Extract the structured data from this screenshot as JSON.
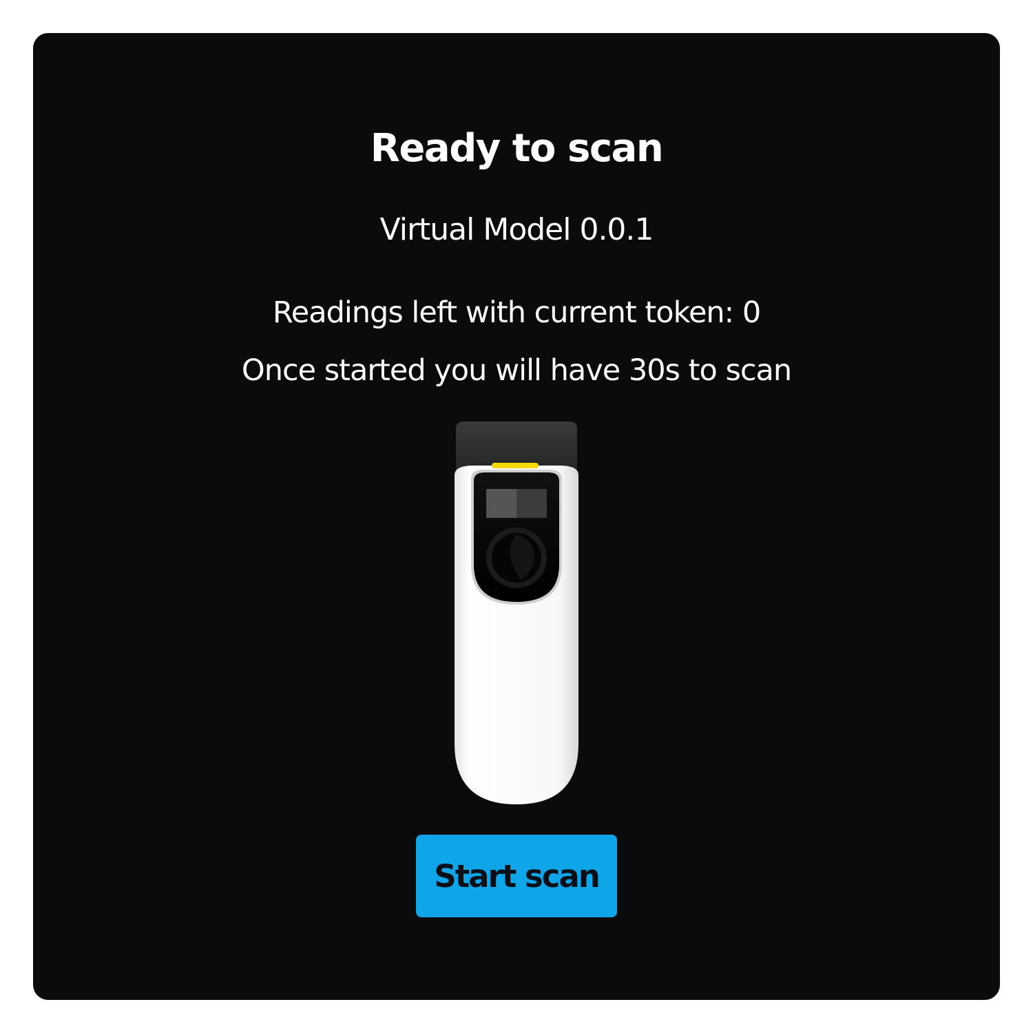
{
  "scan": {
    "title": "Ready to scan",
    "model": "Virtual Model 0.0.1",
    "readings": "Readings left with current token: 0",
    "time_notice": "Once started you will have 30s to scan",
    "start_label": "Start scan"
  },
  "device": {
    "icon": "handheld-scanner-icon",
    "indicator_color": "#f5d800",
    "body_color": "#f5f5f5",
    "cap_color": "#2b2b2b"
  },
  "colors": {
    "background": "#0a0b0d",
    "accent": "#0ea5e9"
  }
}
